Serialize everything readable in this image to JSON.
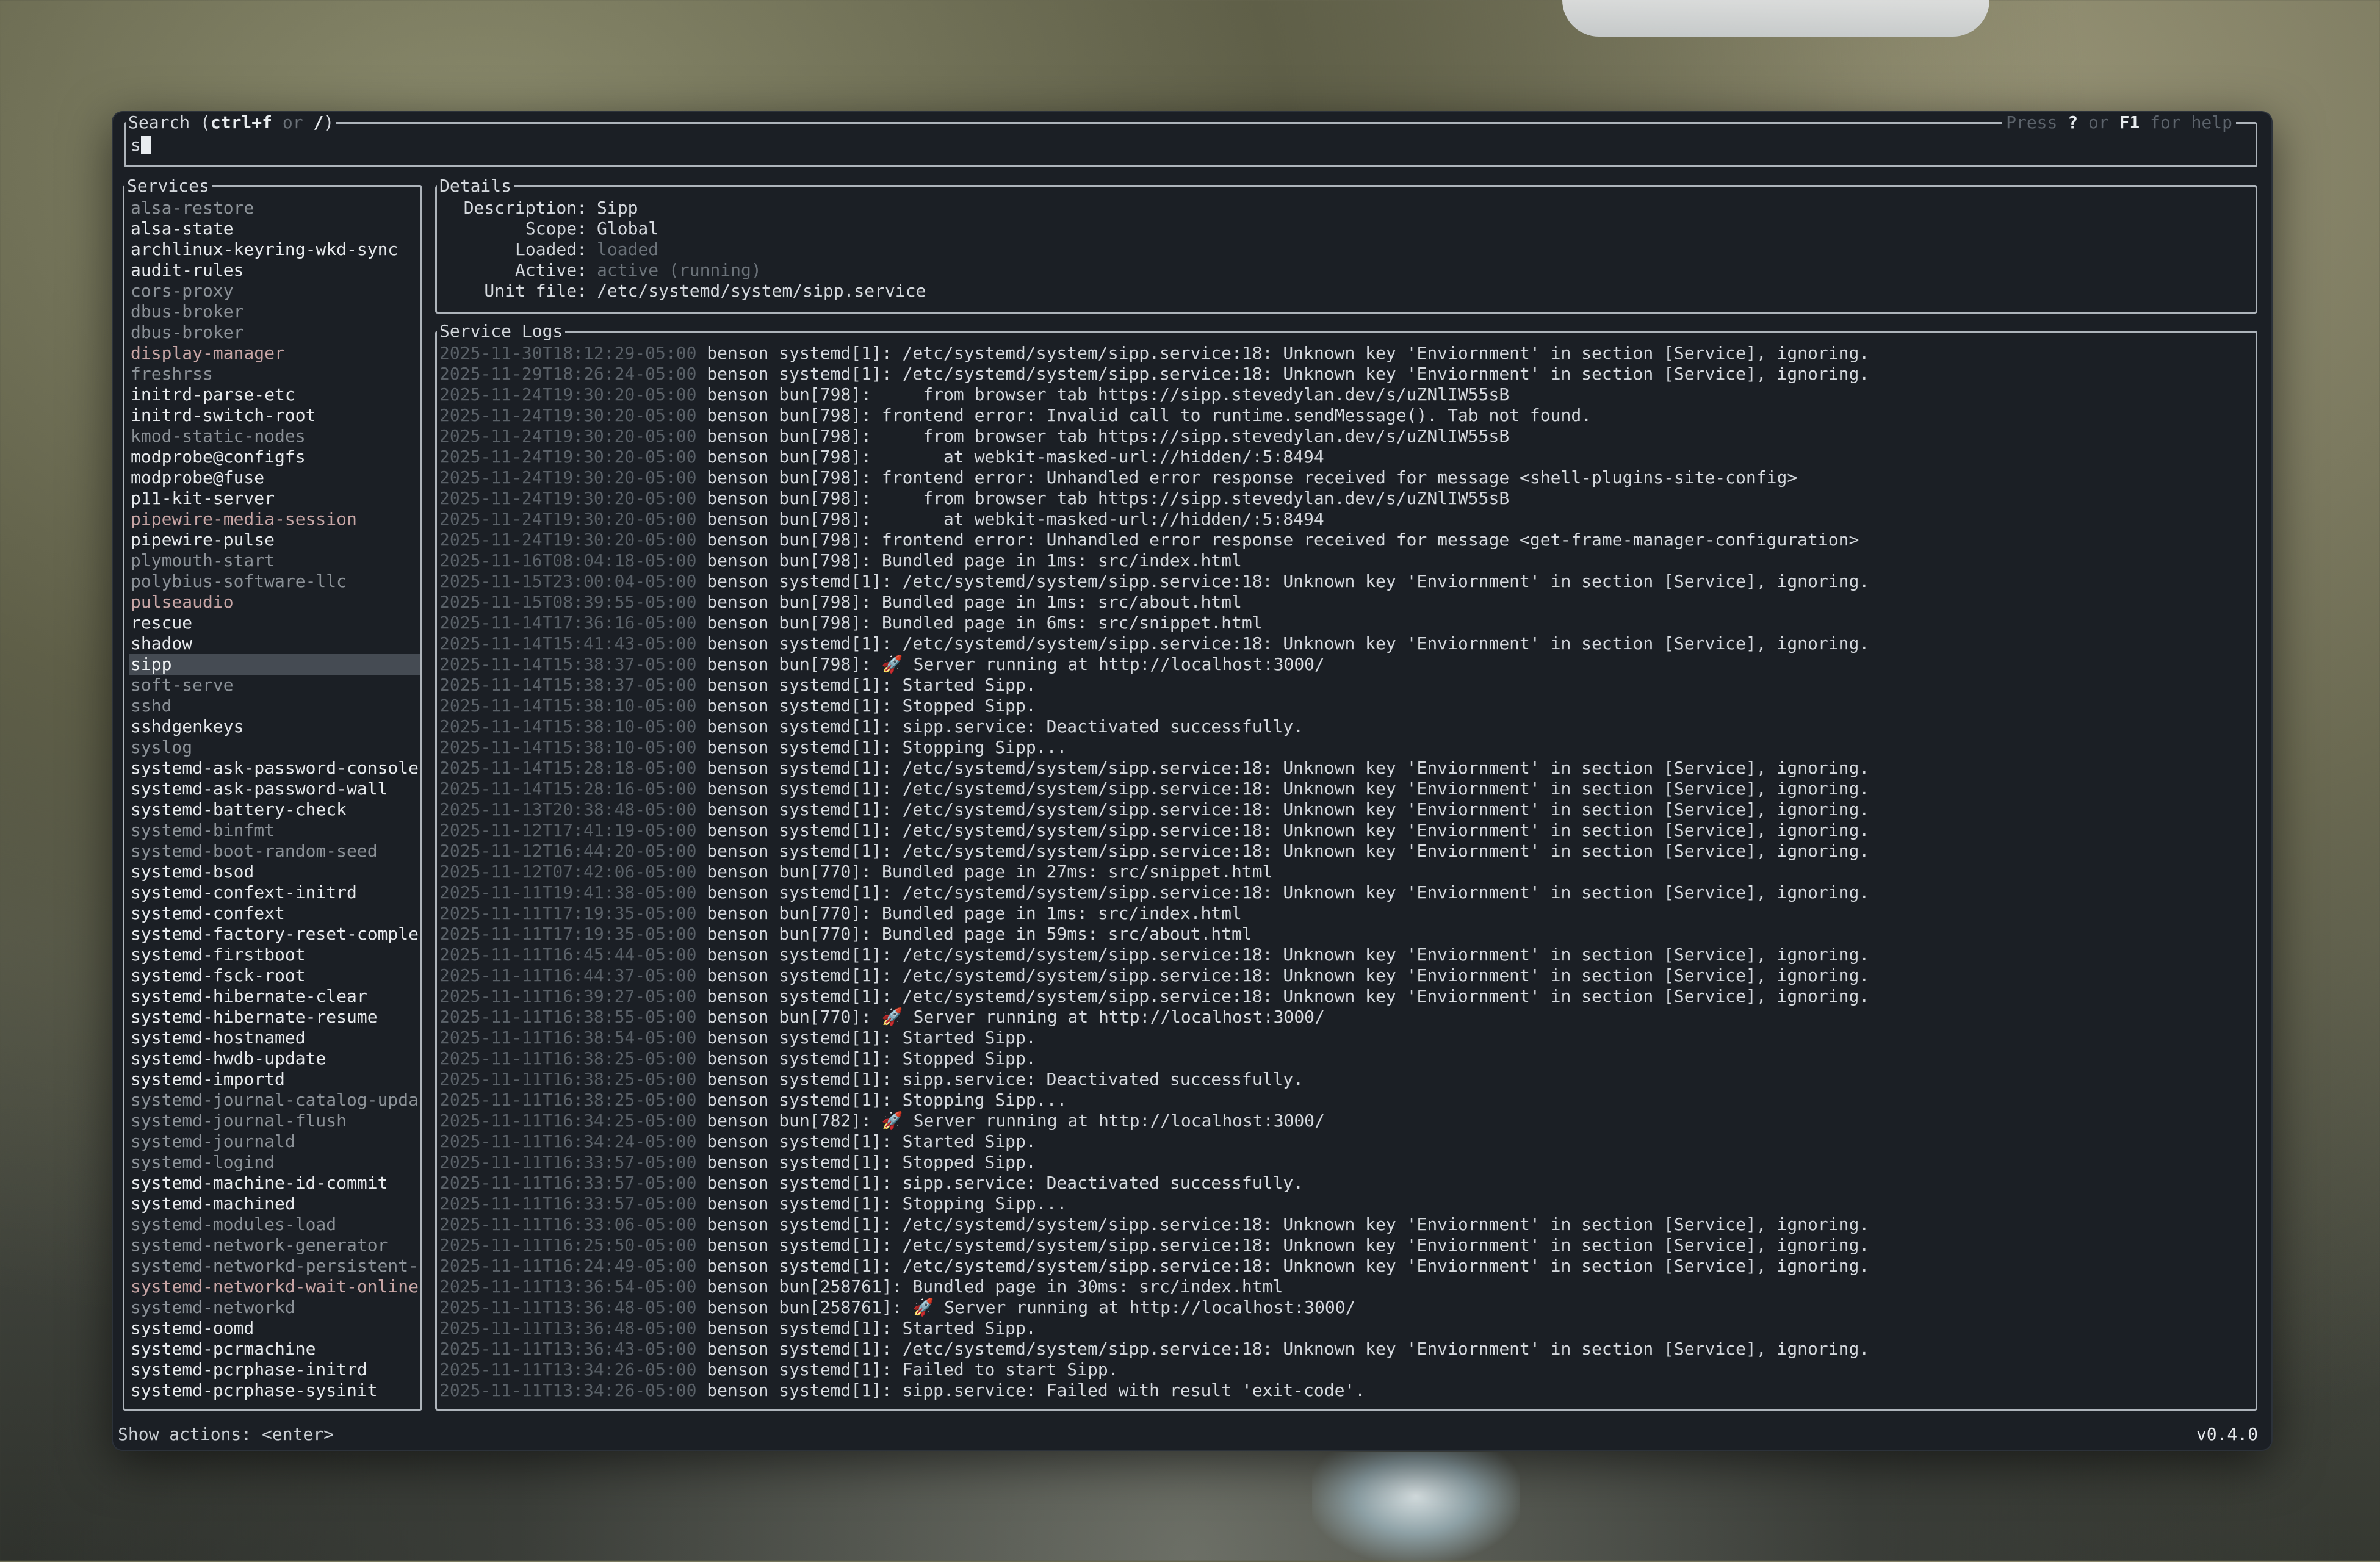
{
  "search": {
    "title_prefix": "Search (",
    "shortcut1": "ctrl+f",
    "or": " or ",
    "shortcut2": "/",
    "title_suffix": ")",
    "help_press": "Press ",
    "help_key1": "?",
    "help_or": " or ",
    "help_key2": "F1",
    "help_suffix": " for help",
    "value": "s"
  },
  "services": {
    "title": "Services",
    "items": [
      {
        "label": "alsa-restore",
        "state": "inactive"
      },
      {
        "label": "alsa-state",
        "state": "active"
      },
      {
        "label": "archlinux-keyring-wkd-sync",
        "state": "active"
      },
      {
        "label": "audit-rules",
        "state": "active"
      },
      {
        "label": "cors-proxy",
        "state": "inactive"
      },
      {
        "label": "dbus-broker",
        "state": "inactive"
      },
      {
        "label": "dbus-broker",
        "state": "inactive"
      },
      {
        "label": "display-manager",
        "state": "failed"
      },
      {
        "label": "freshrss",
        "state": "inactive"
      },
      {
        "label": "initrd-parse-etc",
        "state": "active"
      },
      {
        "label": "initrd-switch-root",
        "state": "active"
      },
      {
        "label": "kmod-static-nodes",
        "state": "inactive"
      },
      {
        "label": "modprobe@configfs",
        "state": "active"
      },
      {
        "label": "modprobe@fuse",
        "state": "active"
      },
      {
        "label": "p11-kit-server",
        "state": "active"
      },
      {
        "label": "pipewire-media-session",
        "state": "failed"
      },
      {
        "label": "pipewire-pulse",
        "state": "active"
      },
      {
        "label": "plymouth-start",
        "state": "inactive"
      },
      {
        "label": "polybius-software-llc",
        "state": "inactive"
      },
      {
        "label": "pulseaudio",
        "state": "failed"
      },
      {
        "label": "rescue",
        "state": "active"
      },
      {
        "label": "shadow",
        "state": "active"
      },
      {
        "label": "sipp",
        "state": "selected"
      },
      {
        "label": "soft-serve",
        "state": "inactive"
      },
      {
        "label": "sshd",
        "state": "inactive"
      },
      {
        "label": "sshdgenkeys",
        "state": "active"
      },
      {
        "label": "syslog",
        "state": "inactive"
      },
      {
        "label": "systemd-ask-password-console",
        "state": "active"
      },
      {
        "label": "systemd-ask-password-wall",
        "state": "active"
      },
      {
        "label": "systemd-battery-check",
        "state": "active"
      },
      {
        "label": "systemd-binfmt",
        "state": "inactive"
      },
      {
        "label": "systemd-boot-random-seed",
        "state": "inactive"
      },
      {
        "label": "systemd-bsod",
        "state": "active"
      },
      {
        "label": "systemd-confext-initrd",
        "state": "active"
      },
      {
        "label": "systemd-confext",
        "state": "active"
      },
      {
        "label": "systemd-factory-reset-comple",
        "state": "active"
      },
      {
        "label": "systemd-firstboot",
        "state": "active"
      },
      {
        "label": "systemd-fsck-root",
        "state": "active"
      },
      {
        "label": "systemd-hibernate-clear",
        "state": "active"
      },
      {
        "label": "systemd-hibernate-resume",
        "state": "active"
      },
      {
        "label": "systemd-hostnamed",
        "state": "active"
      },
      {
        "label": "systemd-hwdb-update",
        "state": "active"
      },
      {
        "label": "systemd-importd",
        "state": "active"
      },
      {
        "label": "systemd-journal-catalog-upda",
        "state": "inactive"
      },
      {
        "label": "systemd-journal-flush",
        "state": "inactive"
      },
      {
        "label": "systemd-journald",
        "state": "inactive"
      },
      {
        "label": "systemd-logind",
        "state": "inactive"
      },
      {
        "label": "systemd-machine-id-commit",
        "state": "active"
      },
      {
        "label": "systemd-machined",
        "state": "active"
      },
      {
        "label": "systemd-modules-load",
        "state": "inactive"
      },
      {
        "label": "systemd-network-generator",
        "state": "inactive"
      },
      {
        "label": "systemd-networkd-persistent-",
        "state": "inactive"
      },
      {
        "label": "systemd-networkd-wait-online",
        "state": "failed"
      },
      {
        "label": "systemd-networkd",
        "state": "inactive"
      },
      {
        "label": "systemd-oomd",
        "state": "active"
      },
      {
        "label": "systemd-pcrmachine",
        "state": "active"
      },
      {
        "label": "systemd-pcrphase-initrd",
        "state": "active"
      },
      {
        "label": "systemd-pcrphase-sysinit",
        "state": "active"
      }
    ]
  },
  "details": {
    "title": "Details",
    "rows": [
      {
        "key": "Description:",
        "value": "Sipp",
        "muted": false
      },
      {
        "key": "Scope:",
        "value": "Global",
        "muted": false
      },
      {
        "key": "Loaded:",
        "value": "loaded",
        "muted": true
      },
      {
        "key": "Active:",
        "value": "active (running)",
        "muted": true
      },
      {
        "key": "Unit file:",
        "value": "/etc/systemd/system/sipp.service",
        "muted": false
      }
    ]
  },
  "logs": {
    "title": "Service Logs",
    "entries": [
      {
        "ts": "2025-11-30T18:12:29-05:00",
        "msg": "benson systemd[1]: /etc/systemd/system/sipp.service:18: Unknown key 'Enviornment' in section [Service], ignoring."
      },
      {
        "ts": "2025-11-29T18:26:24-05:00",
        "msg": "benson systemd[1]: /etc/systemd/system/sipp.service:18: Unknown key 'Enviornment' in section [Service], ignoring."
      },
      {
        "ts": "2025-11-24T19:30:20-05:00",
        "msg": "benson bun[798]:     from browser tab https://sipp.stevedylan.dev/s/uZNlIW55sB"
      },
      {
        "ts": "2025-11-24T19:30:20-05:00",
        "msg": "benson bun[798]: frontend error: Invalid call to runtime.sendMessage(). Tab not found."
      },
      {
        "ts": "2025-11-24T19:30:20-05:00",
        "msg": "benson bun[798]:     from browser tab https://sipp.stevedylan.dev/s/uZNlIW55sB"
      },
      {
        "ts": "2025-11-24T19:30:20-05:00",
        "msg": "benson bun[798]:       at webkit-masked-url://hidden/:5:8494"
      },
      {
        "ts": "2025-11-24T19:30:20-05:00",
        "msg": "benson bun[798]: frontend error: Unhandled error response received for message <shell-plugins-site-config>"
      },
      {
        "ts": "2025-11-24T19:30:20-05:00",
        "msg": "benson bun[798]:     from browser tab https://sipp.stevedylan.dev/s/uZNlIW55sB"
      },
      {
        "ts": "2025-11-24T19:30:20-05:00",
        "msg": "benson bun[798]:       at webkit-masked-url://hidden/:5:8494"
      },
      {
        "ts": "2025-11-24T19:30:20-05:00",
        "msg": "benson bun[798]: frontend error: Unhandled error response received for message <get-frame-manager-configuration>"
      },
      {
        "ts": "2025-11-16T08:04:18-05:00",
        "msg": "benson bun[798]: Bundled page in 1ms: src/index.html"
      },
      {
        "ts": "2025-11-15T23:00:04-05:00",
        "msg": "benson systemd[1]: /etc/systemd/system/sipp.service:18: Unknown key 'Enviornment' in section [Service], ignoring."
      },
      {
        "ts": "2025-11-15T08:39:55-05:00",
        "msg": "benson bun[798]: Bundled page in 1ms: src/about.html"
      },
      {
        "ts": "2025-11-14T17:36:16-05:00",
        "msg": "benson bun[798]: Bundled page in 6ms: src/snippet.html"
      },
      {
        "ts": "2025-11-14T15:41:43-05:00",
        "msg": "benson systemd[1]: /etc/systemd/system/sipp.service:18: Unknown key 'Enviornment' in section [Service], ignoring."
      },
      {
        "ts": "2025-11-14T15:38:37-05:00",
        "msg": "benson bun[798]: 🚀 Server running at http://localhost:3000/"
      },
      {
        "ts": "2025-11-14T15:38:37-05:00",
        "msg": "benson systemd[1]: Started Sipp."
      },
      {
        "ts": "2025-11-14T15:38:10-05:00",
        "msg": "benson systemd[1]: Stopped Sipp."
      },
      {
        "ts": "2025-11-14T15:38:10-05:00",
        "msg": "benson systemd[1]: sipp.service: Deactivated successfully."
      },
      {
        "ts": "2025-11-14T15:38:10-05:00",
        "msg": "benson systemd[1]: Stopping Sipp..."
      },
      {
        "ts": "2025-11-14T15:28:18-05:00",
        "msg": "benson systemd[1]: /etc/systemd/system/sipp.service:18: Unknown key 'Enviornment' in section [Service], ignoring."
      },
      {
        "ts": "2025-11-14T15:28:16-05:00",
        "msg": "benson systemd[1]: /etc/systemd/system/sipp.service:18: Unknown key 'Enviornment' in section [Service], ignoring."
      },
      {
        "ts": "2025-11-13T20:38:48-05:00",
        "msg": "benson systemd[1]: /etc/systemd/system/sipp.service:18: Unknown key 'Enviornment' in section [Service], ignoring."
      },
      {
        "ts": "2025-11-12T17:41:19-05:00",
        "msg": "benson systemd[1]: /etc/systemd/system/sipp.service:18: Unknown key 'Enviornment' in section [Service], ignoring."
      },
      {
        "ts": "2025-11-12T16:44:20-05:00",
        "msg": "benson systemd[1]: /etc/systemd/system/sipp.service:18: Unknown key 'Enviornment' in section [Service], ignoring."
      },
      {
        "ts": "2025-11-12T07:42:06-05:00",
        "msg": "benson bun[770]: Bundled page in 27ms: src/snippet.html"
      },
      {
        "ts": "2025-11-11T19:41:38-05:00",
        "msg": "benson systemd[1]: /etc/systemd/system/sipp.service:18: Unknown key 'Enviornment' in section [Service], ignoring."
      },
      {
        "ts": "2025-11-11T17:19:35-05:00",
        "msg": "benson bun[770]: Bundled page in 1ms: src/index.html"
      },
      {
        "ts": "2025-11-11T17:19:35-05:00",
        "msg": "benson bun[770]: Bundled page in 59ms: src/about.html"
      },
      {
        "ts": "2025-11-11T16:45:44-05:00",
        "msg": "benson systemd[1]: /etc/systemd/system/sipp.service:18: Unknown key 'Enviornment' in section [Service], ignoring."
      },
      {
        "ts": "2025-11-11T16:44:37-05:00",
        "msg": "benson systemd[1]: /etc/systemd/system/sipp.service:18: Unknown key 'Enviornment' in section [Service], ignoring."
      },
      {
        "ts": "2025-11-11T16:39:27-05:00",
        "msg": "benson systemd[1]: /etc/systemd/system/sipp.service:18: Unknown key 'Enviornment' in section [Service], ignoring."
      },
      {
        "ts": "2025-11-11T16:38:55-05:00",
        "msg": "benson bun[770]: 🚀 Server running at http://localhost:3000/"
      },
      {
        "ts": "2025-11-11T16:38:54-05:00",
        "msg": "benson systemd[1]: Started Sipp."
      },
      {
        "ts": "2025-11-11T16:38:25-05:00",
        "msg": "benson systemd[1]: Stopped Sipp."
      },
      {
        "ts": "2025-11-11T16:38:25-05:00",
        "msg": "benson systemd[1]: sipp.service: Deactivated successfully."
      },
      {
        "ts": "2025-11-11T16:38:25-05:00",
        "msg": "benson systemd[1]: Stopping Sipp..."
      },
      {
        "ts": "2025-11-11T16:34:25-05:00",
        "msg": "benson bun[782]: 🚀 Server running at http://localhost:3000/"
      },
      {
        "ts": "2025-11-11T16:34:24-05:00",
        "msg": "benson systemd[1]: Started Sipp."
      },
      {
        "ts": "2025-11-11T16:33:57-05:00",
        "msg": "benson systemd[1]: Stopped Sipp."
      },
      {
        "ts": "2025-11-11T16:33:57-05:00",
        "msg": "benson systemd[1]: sipp.service: Deactivated successfully."
      },
      {
        "ts": "2025-11-11T16:33:57-05:00",
        "msg": "benson systemd[1]: Stopping Sipp..."
      },
      {
        "ts": "2025-11-11T16:33:06-05:00",
        "msg": "benson systemd[1]: /etc/systemd/system/sipp.service:18: Unknown key 'Enviornment' in section [Service], ignoring."
      },
      {
        "ts": "2025-11-11T16:25:50-05:00",
        "msg": "benson systemd[1]: /etc/systemd/system/sipp.service:18: Unknown key 'Enviornment' in section [Service], ignoring."
      },
      {
        "ts": "2025-11-11T16:24:49-05:00",
        "msg": "benson systemd[1]: /etc/systemd/system/sipp.service:18: Unknown key 'Enviornment' in section [Service], ignoring."
      },
      {
        "ts": "2025-11-11T13:36:54-05:00",
        "msg": "benson bun[258761]: Bundled page in 30ms: src/index.html"
      },
      {
        "ts": "2025-11-11T13:36:48-05:00",
        "msg": "benson bun[258761]: 🚀 Server running at http://localhost:3000/"
      },
      {
        "ts": "2025-11-11T13:36:48-05:00",
        "msg": "benson systemd[1]: Started Sipp."
      },
      {
        "ts": "2025-11-11T13:36:43-05:00",
        "msg": "benson systemd[1]: /etc/systemd/system/sipp.service:18: Unknown key 'Enviornment' in section [Service], ignoring."
      },
      {
        "ts": "2025-11-11T13:34:26-05:00",
        "msg": "benson systemd[1]: Failed to start Sipp."
      },
      {
        "ts": "2025-11-11T13:34:26-05:00",
        "msg": "benson systemd[1]: sipp.service: Failed with result 'exit-code'."
      }
    ]
  },
  "status_bar": {
    "actions": "Show actions: <enter>",
    "version": "v0.4.0"
  },
  "colors": {
    "window_bg": "#1b1f25",
    "border": "#aeb4bb",
    "selected_bg": "#454b53",
    "timestamp": "#5a6168",
    "failed": "#c7a5a5"
  }
}
